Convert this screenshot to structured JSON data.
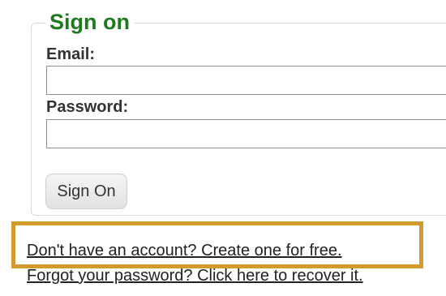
{
  "signon_form": {
    "legend": "Sign on",
    "email_label": "Email:",
    "email_value": "",
    "password_label": "Password:",
    "password_value": "",
    "submit_label": "Sign On"
  },
  "links": {
    "create_account": "Don't have an account? Create one for free.",
    "recover_password": "Forgot your password? Click here to recover it."
  },
  "colors": {
    "legend_green": "#1d7a1d",
    "highlight_border": "#d39a2e"
  }
}
